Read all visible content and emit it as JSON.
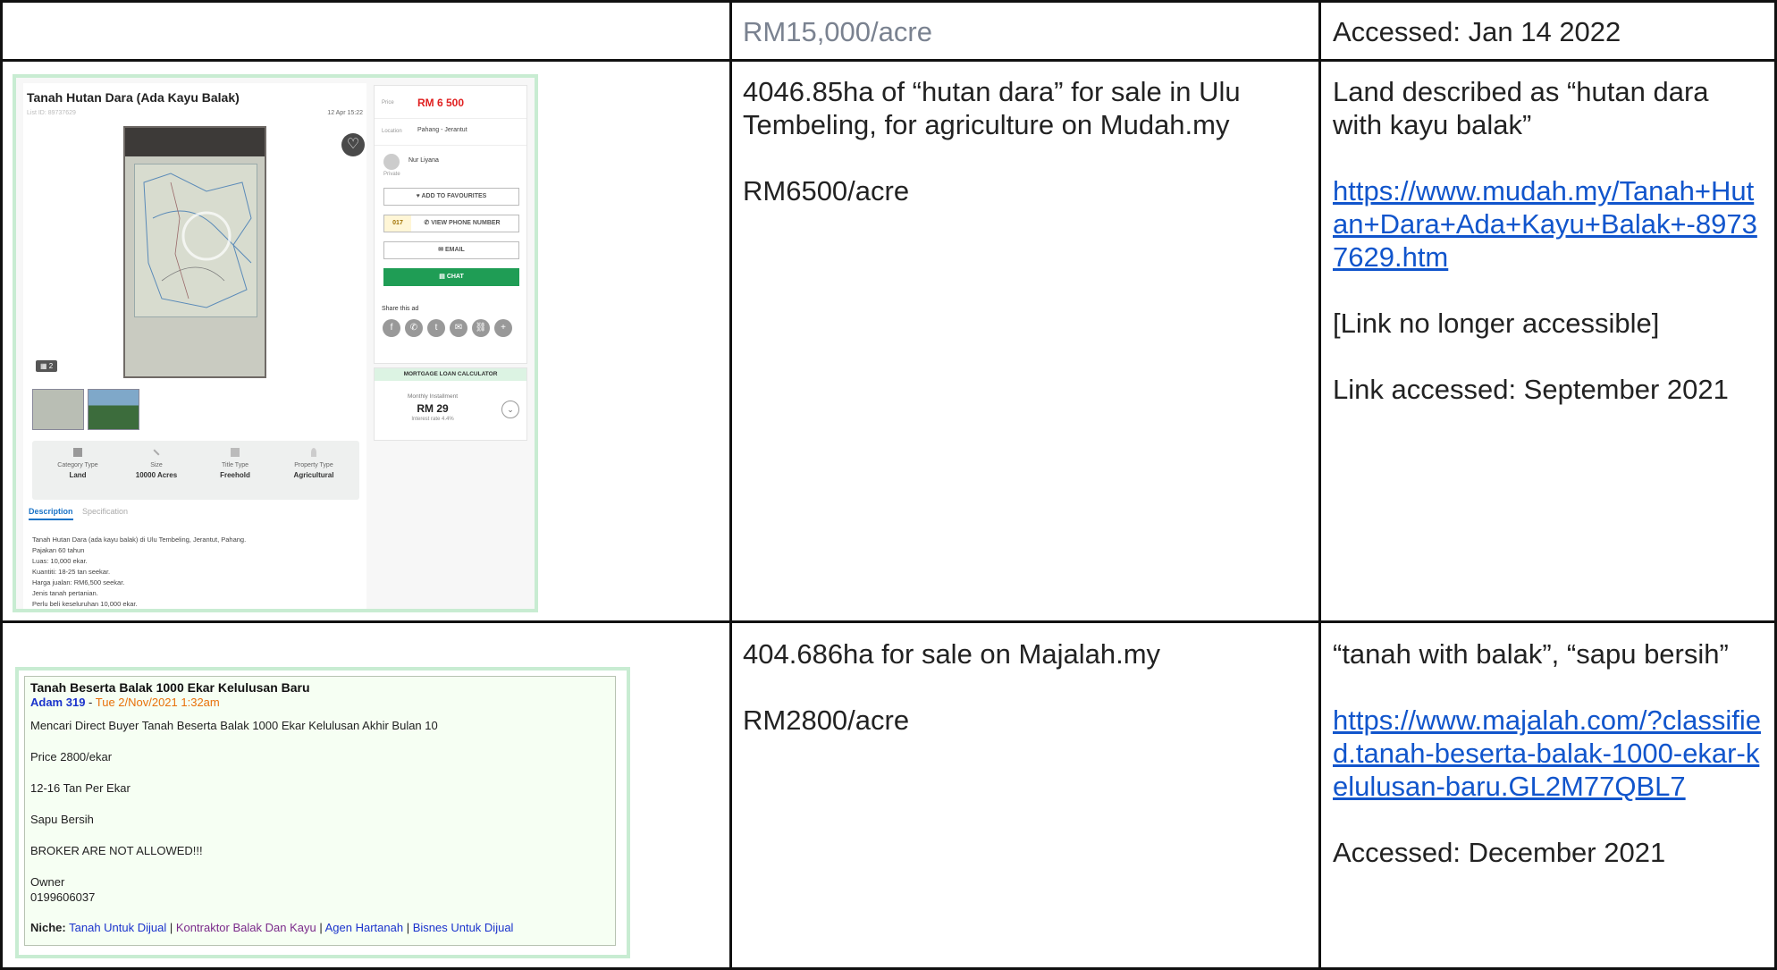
{
  "row1": {
    "col2": "RM15,000/acre",
    "col3": "Accessed: Jan 14 2022"
  },
  "row2": {
    "col2_line1": "4046.85ha of “hutan dara” for sale in Ulu Tembeling, for agriculture on Mudah.my",
    "col2_line2": "RM6500/acre",
    "col3_line1": "Land described as “hutan dara with kayu balak”",
    "col3_link": "https://www.mudah.my/Tanah+Hutan+Dara+Ada+Kayu+Balak+-89737629.htm",
    "col3_line3": "[Link no longer accessible]",
    "col3_line4": "Link accessed: September 2021",
    "shot": {
      "title": "Tanah Hutan Dara (Ada Kayu Balak)",
      "list_id": "List ID: 89737629",
      "date": "12 Apr 15:22",
      "photo_count": "2",
      "props": [
        {
          "label": "Category Type",
          "value": "Land"
        },
        {
          "label": "Size",
          "value": "10000 Acres"
        },
        {
          "label": "Title Type",
          "value": "Freehold"
        },
        {
          "label": "Property Type",
          "value": "Agricultural"
        }
      ],
      "tab_active": "Description",
      "tab_other": "Specification",
      "description": [
        "Tanah Hutan Dara (ada kayu balak) di Ulu Tembeling, Jerantut, Pahang.",
        "Pajakan 60 tahun",
        "Luas: 10,000 ekar.",
        "Kuantiti: 18-25 tan seekar.",
        "Harga jualan: RM6,500 seekar.",
        "Jenis tanah pertanian.",
        "Perlu beli keseluruhan 10,000 ekar."
      ],
      "price_label": "Price",
      "price": "RM 6 500",
      "location_label": "Location",
      "location": "Pahang - Jerantut",
      "seller": "Nur Liyana",
      "seller_type": "Private",
      "fav_btn": "ADD TO FAVOURITES",
      "phone_prefix": "017",
      "phone_btn": "VIEW PHONE NUMBER",
      "email_btn": "EMAIL",
      "chat_btn": "CHAT",
      "share_label": "Share this ad",
      "mortgage_title": "MORTGAGE LOAN CALCULATOR",
      "monthly_label": "Monthly Installment",
      "monthly_value": "RM 29",
      "interest": "Interest rate 4.4%"
    }
  },
  "row3": {
    "col2_line1": "404.686ha for sale on Majalah.my",
    "col2_line2": "RM2800/acre",
    "col3_line1": "“tanah with balak”, “sapu bersih”",
    "col3_link": "https://www.majalah.com/?classified.tanah-beserta-balak-1000-ekar-kelulusan-baru.GL2M77QBL7",
    "col3_line3": "Accessed: December 2021",
    "shot": {
      "title": "Tanah Beserta Balak 1000 Ekar Kelulusan Baru",
      "user": "Adam 319",
      "sep": " - ",
      "date": "Tue 2/Nov/2021 1:32am",
      "lines": [
        "Mencari Direct Buyer Tanah Beserta Balak 1000 Ekar Kelulusan Akhir Bulan 10",
        "Price 2800/ekar",
        "12-16 Tan Per Ekar",
        "Sapu Bersih",
        "BROKER ARE NOT ALLOWED!!!",
        "Owner",
        "0199606037"
      ],
      "niche_label": "Niche:",
      "niche1": "Tanah Untuk Dijual",
      "niche2": "Kontraktor Balak Dan Kayu",
      "niche3": "Agen Hartanah",
      "niche4": "Bisnes Untuk Dijual",
      "pipe": "|"
    }
  }
}
